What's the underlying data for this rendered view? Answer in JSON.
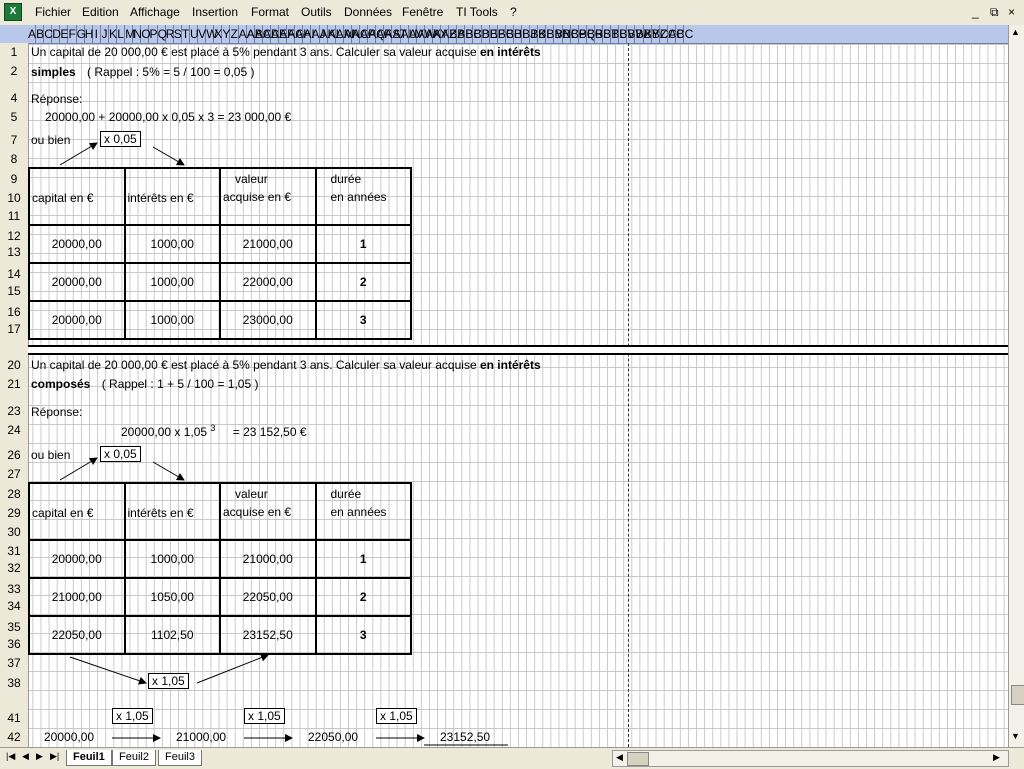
{
  "menu": [
    "Fichier",
    "Edition",
    "Affichage",
    "Insertion",
    "Format",
    "Outils",
    "Données",
    "Fenêtre",
    "TI Tools",
    "?"
  ],
  "window_controls": [
    "_",
    "⧉",
    "×"
  ],
  "columns": [
    "A",
    "B",
    "C",
    "D",
    "E",
    "F",
    "G",
    "H",
    "I",
    "J",
    "K",
    "L",
    "M",
    "N",
    "O",
    "P",
    "Q",
    "R",
    "S",
    "T",
    "U",
    "V",
    "W",
    "X",
    "Y",
    "Z",
    "AA",
    "AB",
    "AC",
    "AD",
    "AE",
    "AF",
    "AG",
    "AH",
    "AI",
    "AJ",
    "AK",
    "AL",
    "AM",
    "AN",
    "AO",
    "AP",
    "AQ",
    "AR",
    "AS",
    "AT",
    "AU",
    "AV",
    "AW",
    "AX",
    "AY",
    "AZ",
    "BA",
    "BB",
    "BC",
    "BD",
    "BE",
    "BF",
    "BG",
    "BH",
    "BI",
    "BJ",
    "BK",
    "BL",
    "BM",
    "BN",
    "BO",
    "BP",
    "BQ",
    "BR",
    "BS",
    "BT",
    "BU",
    "BV",
    "BW",
    "BX",
    "BY",
    "BZ",
    "CA",
    "CB",
    "CC"
  ],
  "rows": {
    "r1": "1",
    "r2": "2",
    "r4": "4",
    "r5": "5",
    "r7": "7",
    "r8": "8",
    "r9": "9",
    "r10": "10",
    "r11": "11",
    "r12": "12",
    "r13": "13",
    "r14": "14",
    "r15": "15",
    "r16": "16",
    "r17": "17",
    "r20": "20",
    "r21": "21",
    "r23": "23",
    "r24": "24",
    "r26": "26",
    "r27": "27",
    "r28": "28",
    "r29": "29",
    "r30": "30",
    "r31": "31",
    "r32": "32",
    "r33": "33",
    "r34": "34",
    "r35": "35",
    "r36": "36",
    "r37": "37",
    "r38": "38",
    "r41": "41",
    "r42": "42"
  },
  "part1": {
    "line1": "Un capital de   20 000,00 €   est placé à   5%   pendant   3   ans.   Calculer sa valeur acquise",
    "line1_bold": "en intérêts",
    "line2_bold": "simples",
    "line2": "( Rappel :   5%   =   5   /   100   =  0,05  )",
    "answer_label": "Réponse:",
    "calc": "20000,00  +   20000,00    x  0,05   x   3    = 23 000,00 €",
    "ou_bien": "ou bien",
    "multiplier": "x  0,05",
    "table_headers": {
      "capital": "capital    en    €",
      "interets": "intérêts  en    €",
      "valeur_top": "valeur",
      "valeur_bottom": "acquise en    €",
      "duree_top": "durée",
      "duree_bottom": "en    années"
    },
    "table_rows": [
      {
        "capital": "20000,00",
        "interets": "1000,00",
        "valeur": "21000,00",
        "duree": "1"
      },
      {
        "capital": "20000,00",
        "interets": "1000,00",
        "valeur": "22000,00",
        "duree": "2"
      },
      {
        "capital": "20000,00",
        "interets": "1000,00",
        "valeur": "23000,00",
        "duree": "3"
      }
    ]
  },
  "part2": {
    "line1": "Un capital de   20 000,00 €   est placé à   5%   pendant   3   ans.   Calculer sa valeur acquise",
    "line1_bold": "en intérêts",
    "line2_bold": "composés",
    "line2": "( Rappel :    1    +   5   /    100    =  1,05  )",
    "answer_label": "Réponse:",
    "calc": "20000,00    x   1,05",
    "exponent": "3",
    "calc_result": "= 23 152,50 €",
    "ou_bien": "ou bien",
    "multiplier": "x  0,05",
    "table_headers": {
      "capital": "capital    en    €",
      "interets": "intérêts  en    €",
      "valeur_top": "valeur",
      "valeur_bottom": "acquise en    €",
      "duree_top": "durée",
      "duree_bottom": "en    années"
    },
    "table_rows": [
      {
        "capital": "20000,00",
        "interets": "1000,00",
        "valeur": "21000,00",
        "duree": "1"
      },
      {
        "capital": "21000,00",
        "interets": "1050,00",
        "valeur": "22050,00",
        "duree": "2"
      },
      {
        "capital": "22050,00",
        "interets": "1102,50",
        "valeur": "23152,50",
        "duree": "3"
      }
    ],
    "coef_box": "x  1,05",
    "chain_values": [
      "20000,00",
      "21000,00",
      "22050,00",
      "23152,50"
    ],
    "chain_box": "x  1,05"
  },
  "tabs": [
    "Feuil1",
    "Feuil2",
    "Feuil3"
  ],
  "active_tab": "Feuil1"
}
